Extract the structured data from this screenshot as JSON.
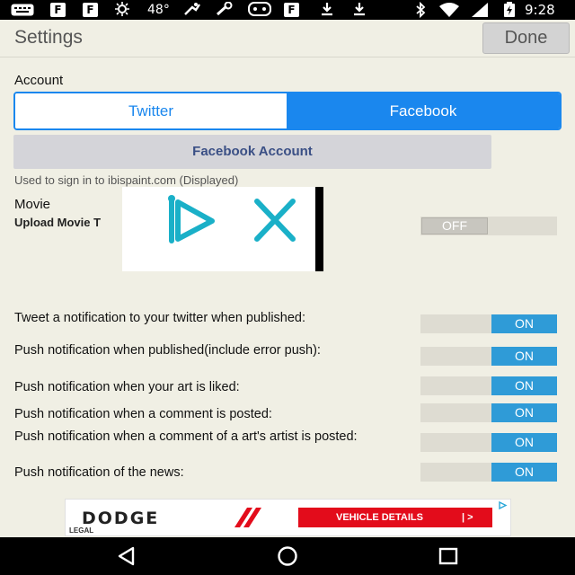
{
  "status_bar": {
    "temperature": "48°",
    "time": "9:28"
  },
  "header": {
    "title": "Settings",
    "done_label": "Done"
  },
  "account": {
    "section_label": "Account",
    "tabs": [
      {
        "label": "Twitter",
        "selected": false
      },
      {
        "label": "Facebook",
        "selected": true
      }
    ],
    "facebook_account_button": "Facebook Account",
    "hint": "Used to sign in to ibispaint.com (Displayed)"
  },
  "movie": {
    "section_label": "Movie",
    "upload_label": "Upload Movie T",
    "upload_toggle": "OFF"
  },
  "notifications": [
    {
      "label": "Tweet a notification to your twitter when published:",
      "state": "ON"
    },
    {
      "label": "Push notification when published(include error push):",
      "state": "ON"
    },
    {
      "label": "Push notification when your art is liked:",
      "state": "ON"
    },
    {
      "label": "Push notification when a comment is posted:",
      "state": "ON"
    },
    {
      "label": "Push notification when a comment of a art's artist is posted:",
      "state": "ON"
    },
    {
      "label": "Push notification of the news:",
      "state": "ON"
    }
  ],
  "ad": {
    "brand": "DODGE",
    "legal": "LEGAL",
    "cta": "VEHICLE DETAILS",
    "cta_arrow": "| >"
  },
  "colors": {
    "accent": "#1a87ee",
    "toggle_on": "#2f9bd7",
    "background": "#f0efe4",
    "ad_red": "#e30c1b"
  },
  "icons": [
    "keyboard-icon",
    "flipboard-icon",
    "weather-icon",
    "tool-icon",
    "gamepad-icon",
    "download-icon",
    "bluetooth-icon",
    "wifi-icon",
    "signal-icon",
    "battery-icon",
    "ibis-logo-icon",
    "close-icon",
    "back-icon",
    "home-icon",
    "recents-icon"
  ]
}
